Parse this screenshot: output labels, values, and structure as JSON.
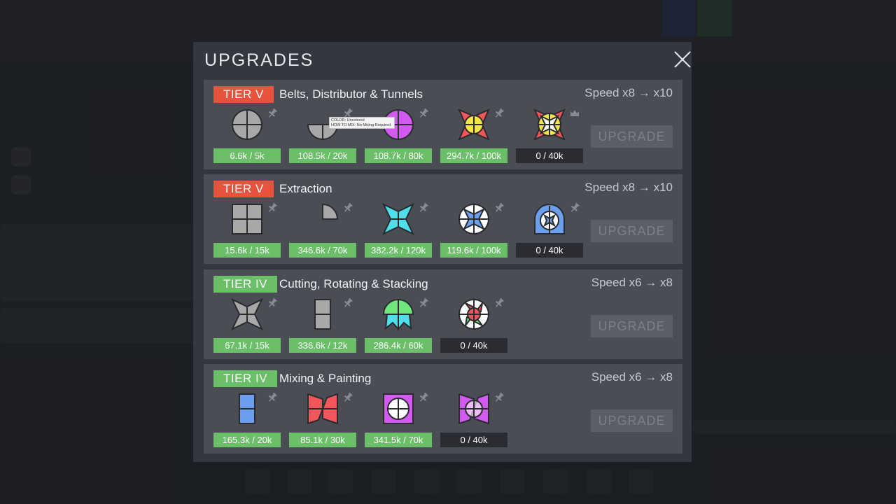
{
  "modal": {
    "title": "UPGRADES"
  },
  "tooltip": {
    "line1": "COLOR: Uncolored",
    "line2": "HOW TO MIX: No Mixing Required"
  },
  "upgrades": [
    {
      "tier": "TIER V",
      "tier_color": "#e8533d",
      "name": "Belts, Distributor & Tunnels",
      "speed": "Speed x8 → x10",
      "button": "UPGRADE",
      "requirements": [
        {
          "shape": "circle-quad-gray",
          "progress": "6.6k / 5k",
          "done": true,
          "icon": "pin-icon"
        },
        {
          "shape": "half-circle-gray",
          "progress": "108.5k / 20k",
          "done": true,
          "icon": "pin-icon"
        },
        {
          "shape": "circle-quad-purple",
          "progress": "108.7k / 80k",
          "done": true,
          "icon": "pin-icon"
        },
        {
          "shape": "star-red-yellow-circle",
          "progress": "294.7k / 100k",
          "done": true,
          "icon": "pin-icon"
        },
        {
          "shape": "star-red-yellow-complex",
          "progress": "0 / 40k",
          "done": false,
          "icon": "crown-icon"
        }
      ]
    },
    {
      "tier": "TIER V",
      "tier_color": "#e8533d",
      "name": "Extraction",
      "speed": "Speed x8 → x10",
      "button": "UPGRADE",
      "requirements": [
        {
          "shape": "square-quad-gray",
          "progress": "15.6k / 15k",
          "done": true,
          "icon": "pin-icon"
        },
        {
          "shape": "quarter-circle-gray",
          "progress": "346.6k / 70k",
          "done": true,
          "icon": "pin-icon"
        },
        {
          "shape": "star-cyan",
          "progress": "382.2k / 120k",
          "done": true,
          "icon": "pin-icon"
        },
        {
          "shape": "circle-white-blue-star",
          "progress": "119.6k / 100k",
          "done": true,
          "icon": "pin-icon"
        },
        {
          "shape": "windmill-blue-white",
          "progress": "0 / 40k",
          "done": false,
          "icon": "pin-icon"
        }
      ]
    },
    {
      "tier": "TIER IV",
      "tier_color": "#6cbf69",
      "name": "Cutting, Rotating & Stacking",
      "speed": "Speed x6 → x8",
      "button": "UPGRADE",
      "requirements": [
        {
          "shape": "star-gray",
          "progress": "67.1k / 15k",
          "done": true,
          "icon": "pin-icon"
        },
        {
          "shape": "half-square-gray",
          "progress": "336.6k / 12k",
          "done": true,
          "icon": "pin-icon"
        },
        {
          "shape": "mushroom-green-cyan",
          "progress": "286.4k / 60k",
          "done": true,
          "icon": "pin-icon"
        },
        {
          "shape": "circle-white-red-green",
          "progress": "0 / 40k",
          "done": false,
          "icon": "pin-icon"
        }
      ]
    },
    {
      "tier": "TIER IV",
      "tier_color": "#6cbf69",
      "name": "Mixing & Painting",
      "speed": "Speed x6 → x8",
      "button": "UPGRADE",
      "requirements": [
        {
          "shape": "half-rect-blue",
          "progress": "165.3k / 20k",
          "done": true,
          "icon": "pin-icon"
        },
        {
          "shape": "windmill-red",
          "progress": "85.1k / 30k",
          "done": true,
          "icon": "pin-icon"
        },
        {
          "shape": "square-purple-white-circle",
          "progress": "341.5k / 70k",
          "done": true,
          "icon": "pin-icon"
        },
        {
          "shape": "windmill-purple-circle",
          "progress": "0 / 40k",
          "done": false,
          "icon": "pin-icon"
        }
      ]
    }
  ]
}
